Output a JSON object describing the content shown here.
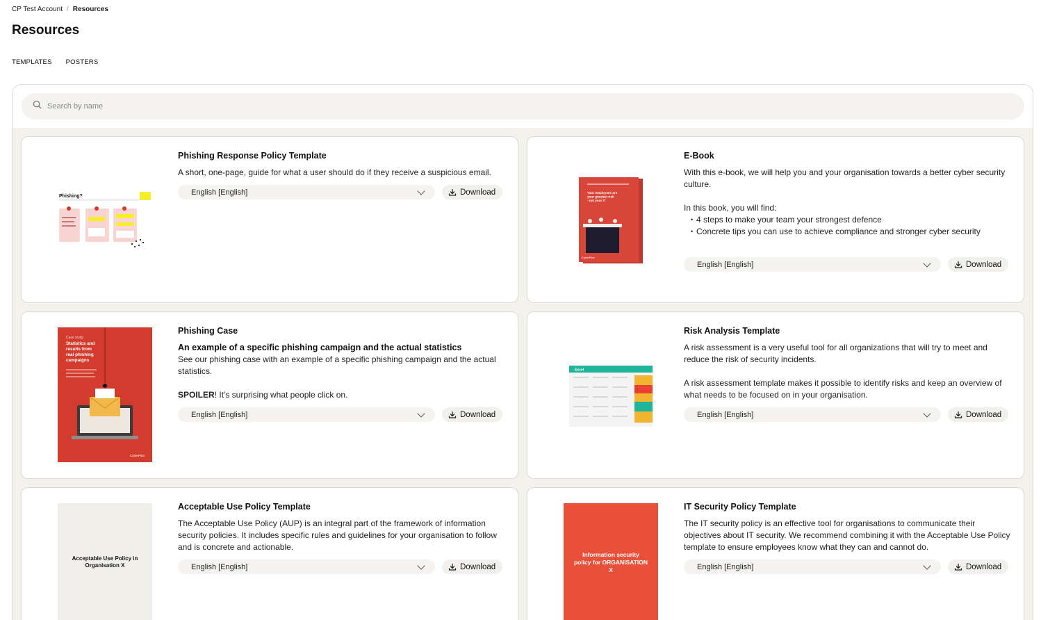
{
  "breadcrumb": {
    "account": "CP Test Account",
    "separator": "/",
    "current": "Resources"
  },
  "page": {
    "title": "Resources"
  },
  "tabs": [
    {
      "label": "TEMPLATES"
    },
    {
      "label": "POSTERS"
    }
  ],
  "search": {
    "placeholder": "Search by name"
  },
  "colors": {
    "accent_red": "#d23b2e",
    "panel_bg": "#f3f2ec",
    "control_bg": "#f4f3ef"
  },
  "cards": [
    {
      "title": "Phishing Response Policy Template",
      "description": [
        "A short, one-page, guide for what a user should do if they receive a suspicious email."
      ],
      "language": "English [English]",
      "download_label": "Download",
      "thumb": {
        "heading": "Phishing?"
      }
    },
    {
      "title": "E-Book",
      "description": [
        "With this e-book, we will help you and your organisation towards a better cyber security culture.",
        "In this book, you will find:"
      ],
      "bullets": [
        "4 steps to make your team your strongest defence",
        "Concrete tips you can use to achieve compliance and stronger cyber security"
      ],
      "language": "English [English]",
      "download_label": "Download",
      "thumb": {
        "heading": "Your employees are your greatest risk - not your IT",
        "brand": "CyberPilot"
      }
    },
    {
      "title": "Phishing Case",
      "subtitle": "An example of a specific phishing campaign and the actual statistics",
      "description": [
        "See our phishing case with an example of a specific phishing campaign and the actual statistics."
      ],
      "spoiler_bold": "SPOILER",
      "spoiler_rest": "! It's surprising what people click on.",
      "language": "English [English]",
      "download_label": "Download",
      "thumb": {
        "kicker": "Case study",
        "heading": "Statistics and results from real phishing campaigns",
        "brand": "CyberPilot"
      }
    },
    {
      "title": "Risk Analysis Template",
      "description": [
        "A risk assessment is a very useful tool for all organizations that will try to meet and reduce the risk of security incidents.",
        "A risk assessment template makes it possible to identify risks and keep an overview of what needs to be focused on in your organisation."
      ],
      "language": "English [English]",
      "download_label": "Download",
      "thumb": {
        "heading": "Excel"
      }
    },
    {
      "title": "Acceptable Use Policy Template",
      "description": [
        "The Acceptable Use Policy (AUP) is an integral part of the framework of information security policies. It includes specific rules and guidelines for your organisation to follow and is concrete and actionable."
      ],
      "language": "English [English]",
      "download_label": "Download",
      "thumb": {
        "heading": "Acceptable Use Policy in Organisation X"
      }
    },
    {
      "title": "IT Security Policy Template",
      "description": [
        "The IT security policy is an effective tool for organisations to communicate their objectives about IT security. We recommend combining it with the Acceptable Use Policy template to ensure employees know what they can and cannot do."
      ],
      "language": "English [English]",
      "download_label": "Download",
      "thumb": {
        "heading": "Information security policy for ORGANISATION X"
      }
    }
  ]
}
